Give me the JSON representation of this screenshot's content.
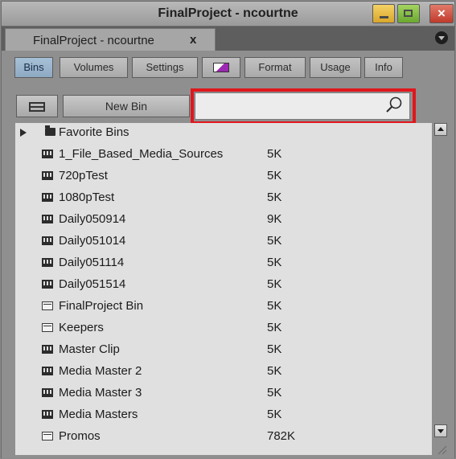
{
  "window": {
    "title": "FinalProject - ncourtne"
  },
  "document_tab": {
    "label": "FinalProject - ncourtne",
    "close_glyph": "x"
  },
  "tabs": [
    {
      "label": "Bins",
      "active": true
    },
    {
      "label": "Volumes",
      "active": false
    },
    {
      "label": "Settings",
      "active": false
    },
    {
      "label": "",
      "icon": "monitor-color-icon",
      "active": false
    },
    {
      "label": "Format",
      "active": false
    },
    {
      "label": "Usage",
      "active": false
    },
    {
      "label": "Info",
      "active": false
    }
  ],
  "toolbar": {
    "new_bin_label": "New Bin",
    "search_value": "",
    "search_icon": "magnifier-icon"
  },
  "highlight_color": "#e0171d",
  "bins": [
    {
      "name": "Favorite Bins",
      "size": "",
      "icon": "folder-icon",
      "expandable": true
    },
    {
      "name": "1_File_Based_Media_Sources",
      "size": "5K",
      "icon": "bin-closed-icon"
    },
    {
      "name": "720pTest",
      "size": "5K",
      "icon": "bin-closed-icon"
    },
    {
      "name": "1080pTest",
      "size": "5K",
      "icon": "bin-closed-icon"
    },
    {
      "name": "Daily050914",
      "size": "9K",
      "icon": "bin-closed-icon"
    },
    {
      "name": "Daily051014",
      "size": "5K",
      "icon": "bin-closed-icon"
    },
    {
      "name": "Daily051114",
      "size": "5K",
      "icon": "bin-closed-icon"
    },
    {
      "name": "Daily051514",
      "size": "5K",
      "icon": "bin-closed-icon"
    },
    {
      "name": "FinalProject Bin",
      "size": "5K",
      "icon": "bin-open-icon"
    },
    {
      "name": "Keepers",
      "size": "5K",
      "icon": "bin-open-icon"
    },
    {
      "name": "Master Clip",
      "size": "5K",
      "icon": "bin-closed-icon"
    },
    {
      "name": "Media Master 2",
      "size": "5K",
      "icon": "bin-closed-icon"
    },
    {
      "name": "Media Master 3",
      "size": "5K",
      "icon": "bin-closed-icon"
    },
    {
      "name": "Media Masters",
      "size": "5K",
      "icon": "bin-closed-icon"
    },
    {
      "name": "Promos",
      "size": "782K",
      "icon": "bin-open-icon"
    }
  ]
}
